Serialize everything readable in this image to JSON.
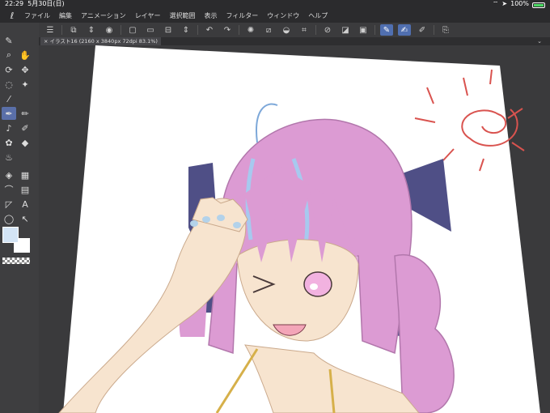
{
  "status": {
    "time": "22:29",
    "date": "5月30日(日)",
    "battery": "100%",
    "icons": [
      "wifi-icon",
      "location-icon",
      "battery-icon"
    ]
  },
  "menu": {
    "items": [
      "ファイル",
      "編集",
      "アニメーション",
      "レイヤー",
      "選択範囲",
      "表示",
      "フィルター",
      "ウィンドウ",
      "ヘルプ"
    ]
  },
  "toolbar": {
    "buttons": [
      "menu",
      "new",
      "save",
      "import",
      "open",
      "export",
      "undo",
      "redo",
      "loading",
      "select",
      "fill",
      "crop",
      "snap-off",
      "snap-ruler",
      "snap-grid",
      "pen-stabilize-1",
      "pen-stabilize-2",
      "pen",
      "copy"
    ]
  },
  "document": {
    "tab_label": "イラスト16 (2160 x 3840px 72dpi 83.1%)"
  },
  "tools": {
    "text_tool_glyph": "A"
  },
  "colors": {
    "main": "#d3e4f5",
    "sub": "#ffffff",
    "accent": "#506fb0"
  }
}
